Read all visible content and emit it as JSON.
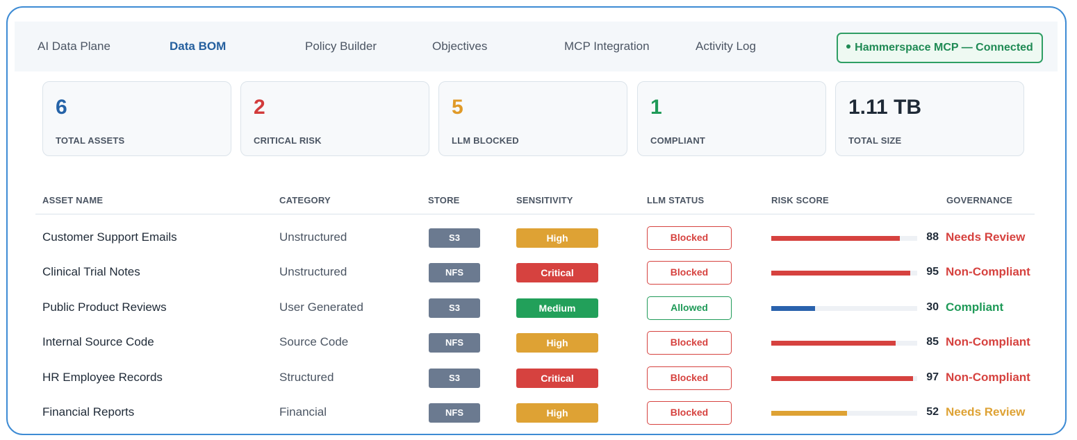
{
  "nav": {
    "tabs": [
      {
        "label": "AI Data Plane"
      },
      {
        "label": "Data BOM"
      },
      {
        "label": "Policy Builder"
      },
      {
        "label": "Objectives"
      },
      {
        "label": "MCP Integration"
      },
      {
        "label": "Activity Log"
      }
    ],
    "active_tab": "Data BOM",
    "mcp_status": "Hammerspace MCP — Connected"
  },
  "stats": [
    {
      "value": "6",
      "label": "TOTAL ASSETS",
      "color": "#2563a8"
    },
    {
      "value": "2",
      "label": "CRITICAL RISK",
      "color": "#d23b3b"
    },
    {
      "value": "5",
      "label": "LLM BLOCKED",
      "color": "#e09a28"
    },
    {
      "value": "1",
      "label": "COMPLIANT",
      "color": "#1f9a58"
    },
    {
      "value": "1.11 TB",
      "label": "TOTAL SIZE",
      "color": "#1f2a37"
    }
  ],
  "table": {
    "headers": {
      "asset_name": "ASSET NAME",
      "category": "CATEGORY",
      "store": "STORE",
      "sensitivity": "SENSITIVITY",
      "llm_status": "LLM STATUS",
      "risk_score": "RISK SCORE",
      "governance": "GOVERNANCE"
    },
    "rows": [
      {
        "name": "Customer Support Emails",
        "category": "Unstructured",
        "store": "S3",
        "sensitivity": "High",
        "llm_status": "Blocked",
        "risk": 88,
        "governance": "Needs Review"
      },
      {
        "name": "Clinical Trial Notes",
        "category": "Unstructured",
        "store": "NFS",
        "sensitivity": "Critical",
        "llm_status": "Blocked",
        "risk": 95,
        "governance": "Non-Compliant"
      },
      {
        "name": "Public Product Reviews",
        "category": "User Generated",
        "store": "S3",
        "sensitivity": "Medium",
        "llm_status": "Allowed",
        "risk": 30,
        "governance": "Compliant"
      },
      {
        "name": "Internal Source Code",
        "category": "Source Code",
        "store": "NFS",
        "sensitivity": "High",
        "llm_status": "Blocked",
        "risk": 85,
        "governance": "Non-Compliant"
      },
      {
        "name": "HR Employee Records",
        "category": "Structured",
        "store": "S3",
        "sensitivity": "Critical",
        "llm_status": "Blocked",
        "risk": 97,
        "governance": "Non-Compliant"
      },
      {
        "name": "Financial Reports",
        "category": "Financial",
        "store": "NFS",
        "sensitivity": "High",
        "llm_status": "Blocked",
        "risk": 52,
        "governance": "Needs Review"
      }
    ]
  },
  "colors": {
    "sensitivity": {
      "High": "#dea234",
      "Critical": "#d6423f",
      "Medium": "#22a05a"
    },
    "llm_status": {
      "Blocked": "#d6423f",
      "Allowed": "#1f9a58"
    },
    "governance": {
      "Needs Review": "#d6423f",
      "Non-Compliant": "#d6423f",
      "Compliant": "#1f9a58"
    },
    "risk_bar": {
      "high": "#d6423f",
      "medium": "#dea234",
      "low": "#2a62ad"
    },
    "financial_governance": "#dea234"
  }
}
